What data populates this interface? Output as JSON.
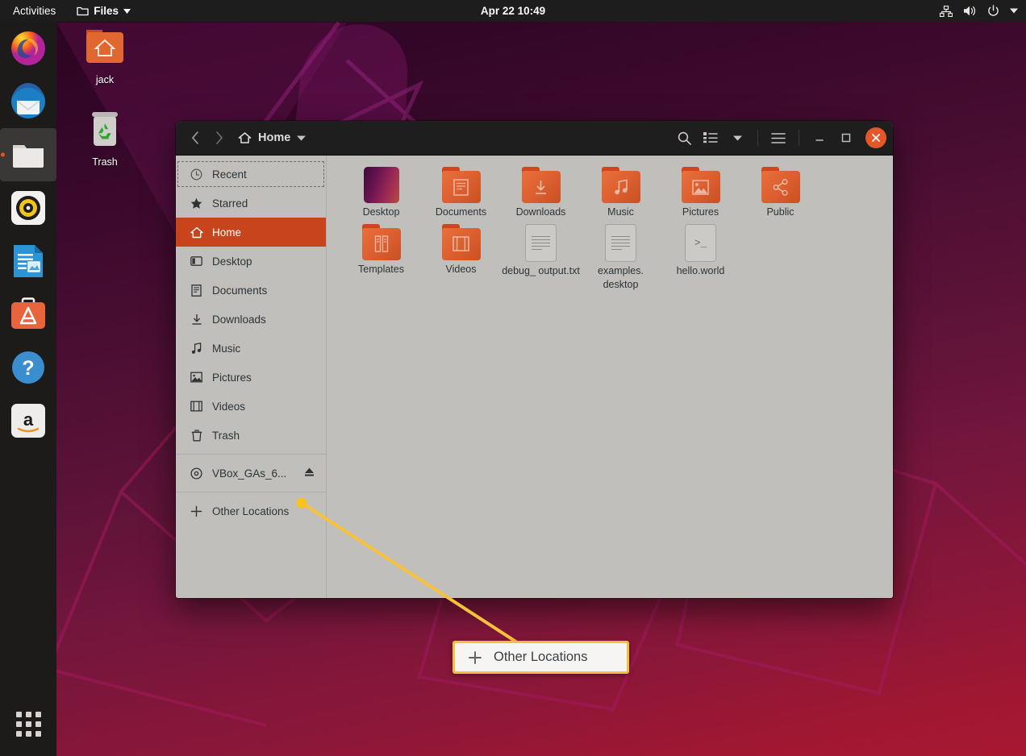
{
  "topbar": {
    "activities": "Activities",
    "app_menu": "Files",
    "app_menu_icon": "folder-icon",
    "clock": "Apr 22  10:49",
    "tray_icons": [
      "network-icon",
      "volume-icon",
      "power-icon",
      "chevron-down-icon"
    ]
  },
  "dock": {
    "items": [
      {
        "name": "firefox",
        "label": "Firefox",
        "active": false
      },
      {
        "name": "thunderbird",
        "label": "Thunderbird",
        "active": false
      },
      {
        "name": "files",
        "label": "Files",
        "active": true
      },
      {
        "name": "rhythmbox",
        "label": "Rhythmbox",
        "active": false
      },
      {
        "name": "libreoffice-writer",
        "label": "LibreOffice Writer",
        "active": false
      },
      {
        "name": "ubuntu-software",
        "label": "Ubuntu Software",
        "active": false
      },
      {
        "name": "help",
        "label": "Help",
        "active": false
      },
      {
        "name": "amazon",
        "label": "Amazon",
        "active": false
      }
    ],
    "show_apps_label": "Show Applications"
  },
  "desktop_icons": [
    {
      "name": "home-folder",
      "label": "jack",
      "icon": "home-folder-icon"
    },
    {
      "name": "trash",
      "label": "Trash",
      "icon": "trash-icon"
    }
  ],
  "window": {
    "header": {
      "back_icon": "chevron-left-icon",
      "forward_icon": "chevron-right-icon",
      "path_icon": "home-icon",
      "path_label": "Home",
      "path_dropdown_icon": "chevron-down-icon",
      "search_icon": "search-icon",
      "view_list_icon": "list-view-icon",
      "view_dropdown_icon": "chevron-down-icon",
      "menu_icon": "hamburger-menu-icon",
      "minimize_icon": "minimize-icon",
      "maximize_icon": "maximize-icon",
      "close_icon": "close-icon"
    },
    "sidebar": {
      "items": [
        {
          "label": "Recent",
          "icon": "clock-icon",
          "state": "focused"
        },
        {
          "label": "Starred",
          "icon": "star-icon",
          "state": "normal"
        },
        {
          "label": "Home",
          "icon": "home-icon",
          "state": "selected"
        },
        {
          "label": "Desktop",
          "icon": "desktop-icon",
          "state": "normal"
        },
        {
          "label": "Documents",
          "icon": "document-icon",
          "state": "normal"
        },
        {
          "label": "Downloads",
          "icon": "download-icon",
          "state": "normal"
        },
        {
          "label": "Music",
          "icon": "music-icon",
          "state": "normal"
        },
        {
          "label": "Pictures",
          "icon": "picture-icon",
          "state": "normal"
        },
        {
          "label": "Videos",
          "icon": "video-icon",
          "state": "normal"
        },
        {
          "label": "Trash",
          "icon": "trash-icon",
          "state": "normal"
        }
      ],
      "device": {
        "label": "VBox_GAs_6...",
        "icon": "disc-icon",
        "eject_icon": "eject-icon"
      },
      "other_locations": {
        "label": "Other Locations",
        "icon": "plus-icon"
      }
    },
    "files": [
      {
        "label": "Desktop",
        "type": "thumbnail",
        "icon": "wallpaper-thumbnail"
      },
      {
        "label": "Documents",
        "type": "folder",
        "icon": "document-folder-icon"
      },
      {
        "label": "Downloads",
        "type": "folder",
        "icon": "download-folder-icon"
      },
      {
        "label": "Music",
        "type": "folder",
        "icon": "music-folder-icon"
      },
      {
        "label": "Pictures",
        "type": "folder",
        "icon": "picture-folder-icon"
      },
      {
        "label": "Public",
        "type": "folder",
        "icon": "share-folder-icon"
      },
      {
        "label": "Templates",
        "type": "folder",
        "icon": "template-folder-icon"
      },
      {
        "label": "Videos",
        "type": "folder",
        "icon": "video-folder-icon"
      },
      {
        "label": "debug_\noutput.txt",
        "type": "text",
        "icon": "text-file-icon"
      },
      {
        "label": "examples.\ndesktop",
        "type": "text",
        "icon": "text-file-icon"
      },
      {
        "label": "hello.world",
        "type": "script",
        "icon": "script-file-icon"
      }
    ]
  },
  "annotation": {
    "callout_label": "Other Locations",
    "callout_icon": "plus-icon",
    "line_color": "#f7c13c",
    "border_color": "#f4bf3f"
  }
}
